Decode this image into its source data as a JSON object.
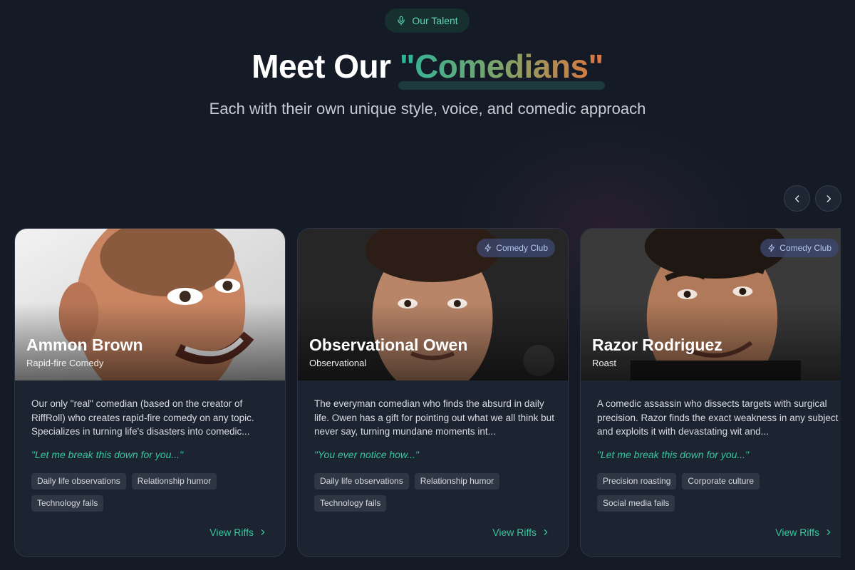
{
  "header": {
    "pill_label": "Our Talent",
    "pill_icon": "microphone-icon",
    "title_prefix": "Meet Our ",
    "title_accent": "\"Comedians\"",
    "subtitle": "Each with their own unique style, voice, and comedic approach"
  },
  "carousel": {
    "prev_icon": "chevron-left-icon",
    "next_icon": "chevron-right-icon"
  },
  "colors": {
    "background": "#141b27",
    "accent_teal": "#38c5a0",
    "accent_orange": "#e2743c",
    "card": "#1c2331"
  },
  "cards": [
    {
      "name": "Ammon Brown",
      "genre": "Rapid-fire Comedy",
      "badge": "",
      "description": "Our only \"real\" comedian (based on the creator of RiffRoll) who creates rapid-fire comedy on any topic. Specializes in turning life's disasters into comedic...",
      "quote": "\"Let me break this down for you...\"",
      "tags": [
        "Daily life observations",
        "Relationship humor",
        "Technology fails"
      ],
      "link": "View Riffs"
    },
    {
      "name": "Observational Owen",
      "genre": "Observational",
      "badge": "Comedy Club",
      "description": "The everyman comedian who finds the absurd in daily life. Owen has a gift for pointing out what we all think but never say, turning mundane moments int...",
      "quote": "\"You ever notice how...\"",
      "tags": [
        "Daily life observations",
        "Relationship humor",
        "Technology fails"
      ],
      "link": "View Riffs"
    },
    {
      "name": "Razor Rodriguez",
      "genre": "Roast",
      "badge": "Comedy Club",
      "description": "A comedic assassin who dissects targets with surgical precision. Razor finds the exact weakness in any subject and exploits it with devastating wit and...",
      "quote": "\"Let me break this down for you...\"",
      "tags": [
        "Precision roasting",
        "Corporate culture",
        "Social media fails"
      ],
      "link": "View Riffs"
    }
  ]
}
